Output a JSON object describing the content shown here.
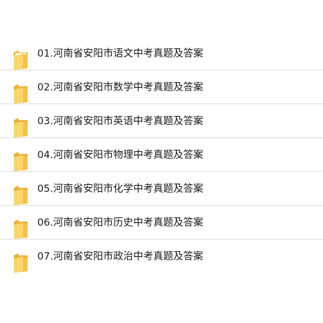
{
  "folders": [
    {
      "label": "01.河南省安阳市语文中考真题及答案",
      "icon": "folder-icon"
    },
    {
      "label": "02.河南省安阳市数学中考真题及答案",
      "icon": "folder-icon"
    },
    {
      "label": "03.河南省安阳市英语中考真题及答案",
      "icon": "folder-icon"
    },
    {
      "label": "04.河南省安阳市物理中考真题及答案",
      "icon": "folder-icon"
    },
    {
      "label": "05.河南省安阳市化学中考真题及答案",
      "icon": "folder-icon"
    },
    {
      "label": "06.河南省安阳市历史中考真题及答案",
      "icon": "folder-icon"
    },
    {
      "label": "07.河南省安阳市政治中考真题及答案",
      "icon": "folder-icon"
    }
  ],
  "colors": {
    "folder_back": "#e8b33e",
    "folder_front": "#f9d56e",
    "folder_paper": "#ffffff",
    "divider": "#dcdcdc",
    "text": "#1a1a1a"
  }
}
